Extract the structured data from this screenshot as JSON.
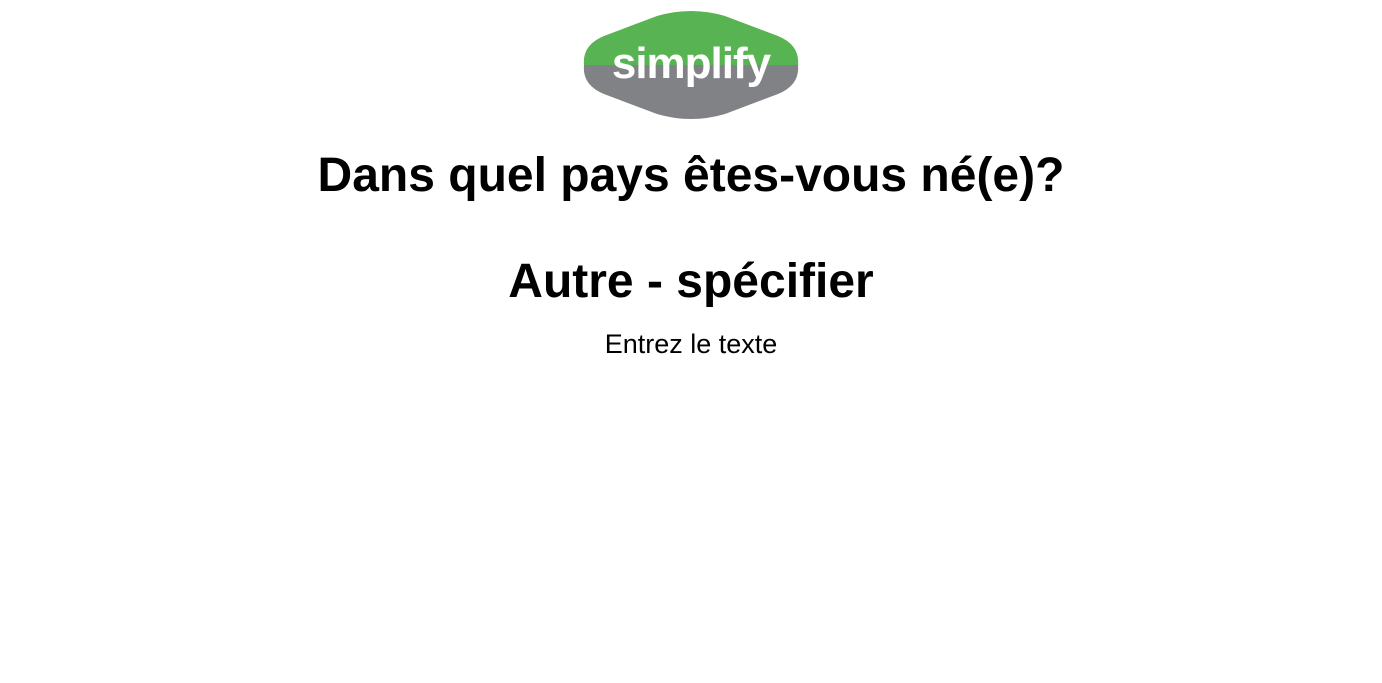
{
  "logo": {
    "text": "simplify",
    "colors": {
      "top": "#58b452",
      "bottom": "#818285",
      "text": "#ffffff"
    }
  },
  "question": {
    "title": "Dans quel pays êtes-vous né(e)?"
  },
  "answer": {
    "option_label": "Autre - spécifier",
    "input_placeholder": "Entrez le texte",
    "input_value": ""
  }
}
